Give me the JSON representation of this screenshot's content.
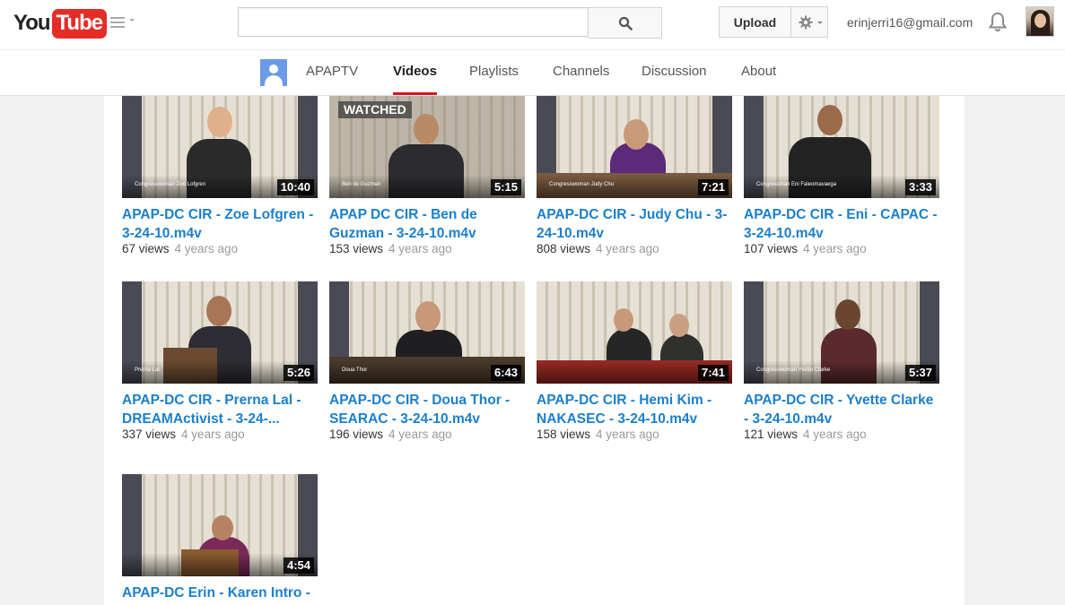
{
  "masthead": {
    "logo_you": "You",
    "logo_tube": "Tube",
    "search_placeholder": "",
    "upload_label": "Upload",
    "account_email": "erinjerri16@gmail.com"
  },
  "channel_nav": {
    "channel_name": "APAPTV",
    "tabs": [
      {
        "label": "Videos",
        "active": true
      },
      {
        "label": "Playlists"
      },
      {
        "label": "Channels"
      },
      {
        "label": "Discussion"
      },
      {
        "label": "About"
      }
    ]
  },
  "videos": [
    {
      "title": "APAP-DC CIR - Zoe Lofgren - 3-24-10.m4v",
      "views": "67 views",
      "ago": "4 years ago",
      "duration": "10:40",
      "caption": "Congresswoman Zoe Lofgren",
      "watched": ""
    },
    {
      "title": "APAP DC CIR - Ben de Guzman - 3-24-10.m4v",
      "views": "153 views",
      "ago": "4 years ago",
      "duration": "5:15",
      "caption": "Ben de Guzman",
      "watched": "WATCHED"
    },
    {
      "title": "APAP-DC CIR - Judy Chu - 3-24-10.m4v",
      "views": "808 views",
      "ago": "4 years ago",
      "duration": "7:21",
      "caption": "Congresswoman Judy Chu",
      "watched": ""
    },
    {
      "title": "APAP-DC CIR - Eni - CAPAC - 3-24-10.m4v",
      "views": "107 views",
      "ago": "4 years ago",
      "duration": "3:33",
      "caption": "Congressman Eni Faleomavaega",
      "watched": ""
    },
    {
      "title": "APAP-DC CIR - Prerna Lal - DREAMActivist - 3-24-...",
      "views": "337 views",
      "ago": "4 years ago",
      "duration": "5:26",
      "caption": "Prerna Lal",
      "watched": ""
    },
    {
      "title": "APAP-DC CIR - Doua Thor - SEARAC - 3-24-10.m4v",
      "views": "196 views",
      "ago": "4 years ago",
      "duration": "6:43",
      "caption": "Doua Thor",
      "watched": ""
    },
    {
      "title": "APAP-DC CIR - Hemi Kim - NAKASEC - 3-24-10.m4v",
      "views": "158 views",
      "ago": "4 years ago",
      "duration": "7:41",
      "caption": "",
      "watched": ""
    },
    {
      "title": "APAP-DC CIR - Yvette Clarke - 3-24-10.m4v",
      "views": "121 views",
      "ago": "4 years ago",
      "duration": "5:37",
      "caption": "Congresswoman Yvette Clarke",
      "watched": ""
    },
    {
      "title": "APAP-DC Erin - Karen Intro -",
      "views": "",
      "ago": "",
      "duration": "4:54",
      "caption": "",
      "watched": ""
    }
  ],
  "colors": {
    "brand_red": "#e52d27",
    "link_blue": "#1b7fcc",
    "active_tab_underline": "#cc181e"
  }
}
